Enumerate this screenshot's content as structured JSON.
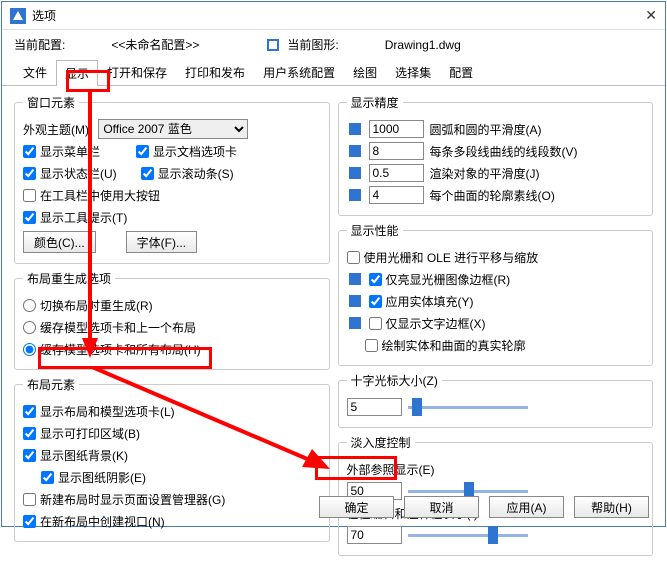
{
  "title": "选项",
  "config_row": {
    "current_config_label": "当前配置:",
    "current_config_value": "<<未命名配置>>",
    "current_drawing_label": "当前图形:",
    "current_drawing_value": "Drawing1.dwg"
  },
  "tabs": [
    "文件",
    "显示",
    "打开和保存",
    "打印和发布",
    "用户系统配置",
    "绘图",
    "选择集",
    "配置"
  ],
  "active_tab": 1,
  "window_elements": {
    "legend": "窗口元素",
    "theme_label": "外观主题(M):",
    "theme_value": "Office 2007 蓝色",
    "show_menu": "显示菜单栏",
    "show_doc_tab": "显示文档选项卡",
    "show_status": "显示状态栏(U)",
    "show_scroll": "显示滚动条(S)",
    "big_buttons": "在工具栏中使用大按钮",
    "show_tooltips": "显示工具提示(T)",
    "color_btn": "颜色(C)...",
    "font_btn": "字体(F)..."
  },
  "layout_regen": {
    "legend": "布局重生成选项",
    "opt1": "切换布局时重生成(R)",
    "opt2": "缓存模型选项卡和上一个布局",
    "opt3": "缓存模型选项卡和所有布局(H)"
  },
  "layout_elem": {
    "legend": "布局元素",
    "c1": "显示布局和模型选项卡(L)",
    "c2": "显示可打印区域(B)",
    "c3": "显示图纸背景(K)",
    "c4": "显示图纸阴影(E)",
    "c5": "新建布局时显示页面设置管理器(G)",
    "c6": "在新布局中创建视口(N)"
  },
  "display_precision": {
    "legend": "显示精度",
    "r1_val": "1000",
    "r1_lbl": "圆弧和圆的平滑度(A)",
    "r2_val": "8",
    "r2_lbl": "每条多段线曲线的线段数(V)",
    "r3_val": "0.5",
    "r3_lbl": "渲染对象的平滑度(J)",
    "r4_val": "4",
    "r4_lbl": "每个曲面的轮廓素线(O)"
  },
  "display_perf": {
    "legend": "显示性能",
    "c1": "使用光栅和 OLE 进行平移与缩放",
    "c2": "仅亮显光栅图像边框(R)",
    "c3": "应用实体填充(Y)",
    "c4": "仅显示文字边框(X)",
    "c5": "绘制实体和曲面的真实轮廓"
  },
  "crosshair": {
    "legend": "十字光标大小(Z)",
    "value": "5"
  },
  "fade": {
    "legend": "淡入度控制",
    "ext_label": "外部参照显示(E)",
    "ext_val": "50",
    "edit_label": "在位编辑和注释性表示(I)",
    "edit_val": "70"
  },
  "buttons": {
    "ok": "确定",
    "cancel": "取消",
    "apply": "应用(A)",
    "help": "帮助(H)"
  }
}
